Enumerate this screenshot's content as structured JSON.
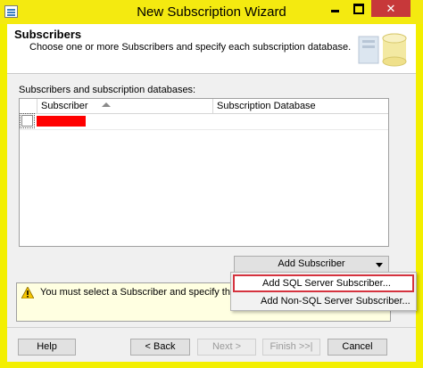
{
  "window": {
    "title": "New Subscription Wizard"
  },
  "header": {
    "title": "Subscribers",
    "subtitle": "Choose one or more Subscribers and specify each subscription database."
  },
  "grid": {
    "label": "Subscribers and subscription databases:",
    "columns": [
      "Subscriber",
      "Subscription Database"
    ],
    "rows": [
      {
        "checked": false,
        "subscriber": "",
        "database": ""
      }
    ]
  },
  "add_subscriber": {
    "label": "Add Subscriber"
  },
  "warning": {
    "text": "You must select a Subscriber and specify the subscr wizard."
  },
  "menu": {
    "items": [
      "Add SQL Server Subscriber...",
      "Add Non-SQL Server Subscriber..."
    ]
  },
  "buttons": {
    "help": "Help",
    "back": "< Back",
    "next": "Next >",
    "finish": "Finish >>|",
    "cancel": "Cancel"
  },
  "colors": {
    "titlebar": "#f4ea10",
    "close": "#c7383a",
    "menu_highlight": "#d5333f",
    "redaction": "#ff0000"
  },
  "icons": [
    "app-icon",
    "minimize-icon",
    "maximize-icon",
    "close-icon",
    "sort-ascending-icon",
    "warning-icon",
    "dropdown-arrow-icon",
    "header-database-graphic"
  ]
}
